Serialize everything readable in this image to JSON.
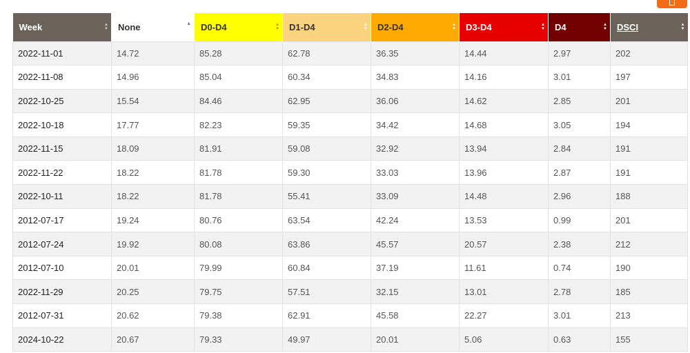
{
  "toolbar": {
    "export_icon": "export-icon"
  },
  "colors": {
    "header_dark": "#6b6259",
    "none_bg": "#ffffff",
    "d0": "#ffff00",
    "d1": "#fcd37f",
    "d2": "#ffaa00",
    "d3": "#e60000",
    "d4": "#730000",
    "accent": "#f26c17"
  },
  "table": {
    "headers": [
      "Week",
      "None",
      "D0-D4",
      "D1-D4",
      "D2-D4",
      "D3-D4",
      "D4",
      "DSCI"
    ],
    "sorted_column": "None",
    "sort_direction": "ascending",
    "rows": [
      [
        "2022-11-01",
        "14.72",
        "85.28",
        "62.78",
        "36.35",
        "14.44",
        "2.97",
        "202"
      ],
      [
        "2022-11-08",
        "14.96",
        "85.04",
        "60.34",
        "34.83",
        "14.16",
        "3.01",
        "197"
      ],
      [
        "2022-10-25",
        "15.54",
        "84.46",
        "62.95",
        "36.06",
        "14.62",
        "2.85",
        "201"
      ],
      [
        "2022-10-18",
        "17.77",
        "82.23",
        "59.35",
        "34.42",
        "14.68",
        "3.05",
        "194"
      ],
      [
        "2022-11-15",
        "18.09",
        "81.91",
        "59.08",
        "32.92",
        "13.94",
        "2.84",
        "191"
      ],
      [
        "2022-11-22",
        "18.22",
        "81.78",
        "59.30",
        "33.03",
        "13.96",
        "2.87",
        "191"
      ],
      [
        "2022-10-11",
        "18.22",
        "81.78",
        "55.41",
        "33.09",
        "14.48",
        "2.96",
        "188"
      ],
      [
        "2012-07-17",
        "19.24",
        "80.76",
        "63.54",
        "42.24",
        "13.53",
        "0.99",
        "201"
      ],
      [
        "2012-07-24",
        "19.92",
        "80.08",
        "63.86",
        "45.57",
        "20.57",
        "2.38",
        "212"
      ],
      [
        "2012-07-10",
        "20.01",
        "79.99",
        "60.84",
        "37.19",
        "11.61",
        "0.74",
        "190"
      ],
      [
        "2022-11-29",
        "20.25",
        "79.75",
        "57.51",
        "32.15",
        "13.01",
        "2.78",
        "185"
      ],
      [
        "2012-07-31",
        "20.62",
        "79.38",
        "62.91",
        "45.58",
        "22.27",
        "3.01",
        "213"
      ],
      [
        "2024-10-22",
        "20.67",
        "79.33",
        "49.97",
        "20.01",
        "5.06",
        "0.63",
        "155"
      ]
    ]
  }
}
